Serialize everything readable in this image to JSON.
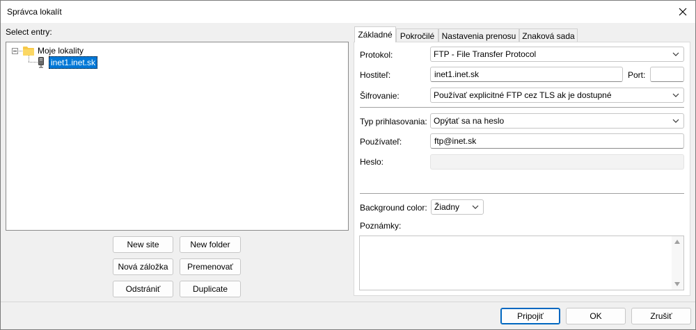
{
  "window": {
    "title": "Správca lokalít"
  },
  "left": {
    "select_label": "Select entry:",
    "tree": {
      "folder_label": "Moje lokality",
      "site_label": "inet1.inet.sk"
    },
    "buttons": {
      "new_site": "New site",
      "new_folder": "New folder",
      "new_bookmark": "Nová záložka",
      "rename": "Premenovať",
      "delete": "Odstrániť",
      "duplicate": "Duplicate"
    }
  },
  "tabs": [
    "Základné",
    "Pokročilé",
    "Nastavenia prenosu",
    "Znaková sada"
  ],
  "general": {
    "protocol_label": "Protokol:",
    "protocol_value": "FTP - File Transfer Protocol",
    "host_label": "Hostiteľ:",
    "host_value": "inet1.inet.sk",
    "port_label": "Port:",
    "port_value": "",
    "encryption_label": "Šifrovanie:",
    "encryption_value": "Používať explicitné FTP cez TLS ak je dostupné",
    "logon_label": "Typ prihlasovania:",
    "logon_value": "Opýtať sa na heslo",
    "user_label": "Používateľ:",
    "user_value": "ftp@inet.sk",
    "password_label": "Heslo:",
    "password_value": "",
    "bgcolor_label": "Background color:",
    "bgcolor_value": "Žiadny",
    "notes_label": "Poznámky:",
    "notes_value": ""
  },
  "footer": {
    "connect": "Pripojiť",
    "ok": "OK",
    "cancel": "Zrušiť"
  },
  "colors": {
    "accent": "#0078d7",
    "button_focus": "#0067c0"
  }
}
